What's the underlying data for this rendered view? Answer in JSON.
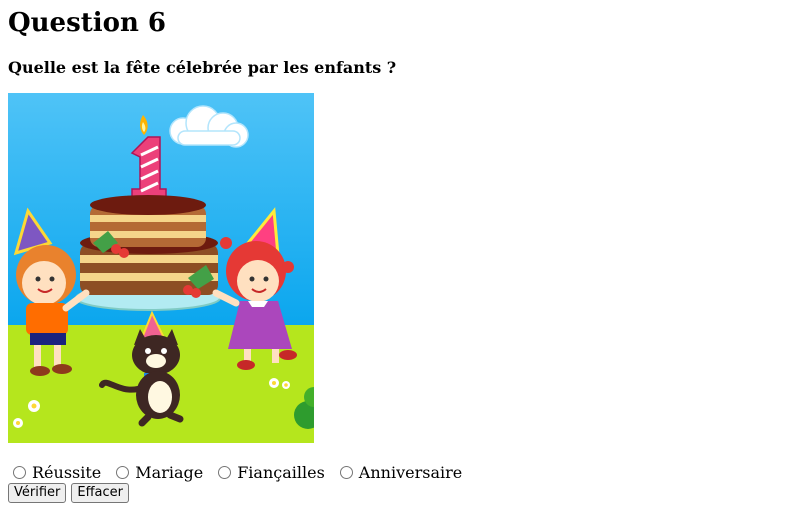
{
  "page": {
    "title": "Question 6",
    "question": "Quelle est la fête célebrée par les enfants ?"
  },
  "illustration": {
    "candle_number": "1"
  },
  "answers": {
    "options": [
      {
        "label": "Réussite",
        "checked": false
      },
      {
        "label": "Mariage",
        "checked": false
      },
      {
        "label": "Fiançailles",
        "checked": false
      },
      {
        "label": "Anniversaire",
        "checked": false
      }
    ]
  },
  "actions": {
    "verify_label": "Vérifier",
    "clear_label": "Effacer"
  }
}
